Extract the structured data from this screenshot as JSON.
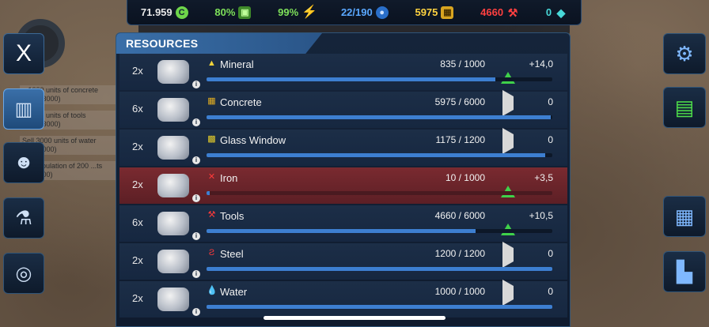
{
  "topbar": {
    "credits": {
      "value": "71.959",
      "icon": "C"
    },
    "cpu": {
      "value": "80%"
    },
    "power": {
      "value": "99%"
    },
    "population": {
      "value": "22/190"
    },
    "concrete": {
      "value": "5975"
    },
    "tools": {
      "value": "4660"
    },
    "crystal": {
      "value": "0"
    }
  },
  "close_label": "X",
  "quests": [
    "...1000 units of concrete (3000/3000)",
    "...3000 units of tools (3000/3000)",
    "Sell 3000 units of water (990/3000)",
    "...a population of 200 ...ts (190/200)"
  ],
  "panel": {
    "title": "RESOURCES"
  },
  "colors": {
    "bar": "#3d7fd1",
    "up": "#3fd14a",
    "alert_row": "#7a2a30"
  },
  "resources": [
    {
      "mult": "2x",
      "name": "Mineral",
      "icon": "▲",
      "icon_color": "#f0d23a",
      "amount": "835 / 1000",
      "fill": 0.835,
      "trend": "up",
      "rate": "+14,0",
      "alert": false
    },
    {
      "mult": "6x",
      "name": "Concrete",
      "icon": "▦",
      "icon_color": "#e6b020",
      "amount": "5975 / 6000",
      "fill": 0.996,
      "trend": "flat",
      "rate": "0",
      "alert": false
    },
    {
      "mult": "2x",
      "name": "Glass Window",
      "icon": "▩",
      "icon_color": "#e8cf2a",
      "amount": "1175 / 1200",
      "fill": 0.979,
      "trend": "flat",
      "rate": "0",
      "alert": false
    },
    {
      "mult": "2x",
      "name": "Iron",
      "icon": "✕",
      "icon_color": "#ff3a3a",
      "amount": "10 / 1000",
      "fill": 0.01,
      "trend": "up",
      "rate": "+3,5",
      "alert": true
    },
    {
      "mult": "6x",
      "name": "Tools",
      "icon": "⚒",
      "icon_color": "#ff3a3a",
      "amount": "4660 / 6000",
      "fill": 0.777,
      "trend": "up",
      "rate": "+10,5",
      "alert": false
    },
    {
      "mult": "2x",
      "name": "Steel",
      "icon": "Ƨ",
      "icon_color": "#ff3a3a",
      "amount": "1200 / 1200",
      "fill": 1.0,
      "trend": "flat",
      "rate": "0",
      "alert": false
    },
    {
      "mult": "2x",
      "name": "Water",
      "icon": "💧",
      "icon_color": "#3a9cff",
      "amount": "1000 / 1000",
      "fill": 1.0,
      "trend": "flat",
      "rate": "0",
      "alert": false
    }
  ],
  "icons": {
    "left": [
      "building-icon",
      "worker-icon",
      "flask-icon",
      "galaxy-icon"
    ],
    "right": [
      "gear-icon",
      "market-icon",
      "warehouse-icon",
      "city-icon"
    ]
  }
}
